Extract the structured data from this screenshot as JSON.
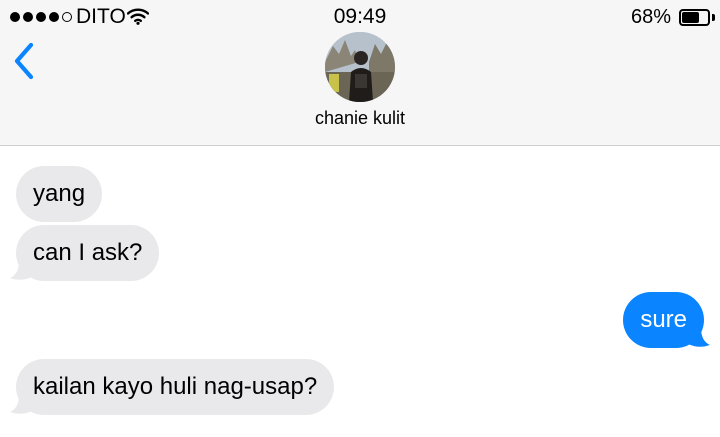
{
  "status_bar": {
    "carrier": "DITO",
    "time": "09:49",
    "battery_percent": "68%",
    "battery_level": 0.68,
    "signal_bars_filled": 4,
    "signal_bars_total": 5
  },
  "header": {
    "contact_name": "chanie kulit",
    "back_icon": "chevron-left-icon",
    "accent_color": "#0a84ff"
  },
  "messages": [
    {
      "direction": "incoming",
      "text": "yang"
    },
    {
      "direction": "incoming",
      "text": "can I ask?"
    },
    {
      "direction": "outgoing",
      "text": "sure"
    },
    {
      "direction": "incoming",
      "text": "kailan kayo huli nag-usap?"
    }
  ],
  "colors": {
    "incoming_bubble": "#e9e9eb",
    "outgoing_bubble": "#0a84ff",
    "header_background": "#f6f6f7"
  }
}
